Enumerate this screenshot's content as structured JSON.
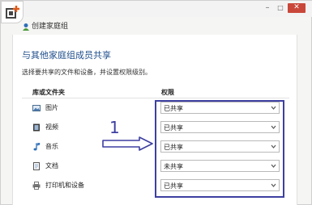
{
  "window": {
    "title_icon": "homegroup-icon",
    "controls": {
      "minimize": "–",
      "maximize": "□",
      "close": "✕"
    }
  },
  "nav": {
    "title": "创建家庭组"
  },
  "content": {
    "heading": "与其他家庭组成员共享",
    "instruction": "选择要共享的文件和设备，并设置权限级别。",
    "columns": {
      "library": "库或文件夹",
      "permission": "权限"
    },
    "rows": [
      {
        "label": "图片",
        "icon": "pictures-icon",
        "permission": "已共享"
      },
      {
        "label": "视频",
        "icon": "videos-icon",
        "permission": "已共享"
      },
      {
        "label": "音乐",
        "icon": "music-icon",
        "permission": "已共享"
      },
      {
        "label": "文档",
        "icon": "documents-icon",
        "permission": "未共享"
      },
      {
        "label": "打印机和设备",
        "icon": "printer-icon",
        "permission": "已共享"
      }
    ]
  },
  "annotation": {
    "step_number": "1",
    "color": "#3d3fa0"
  }
}
